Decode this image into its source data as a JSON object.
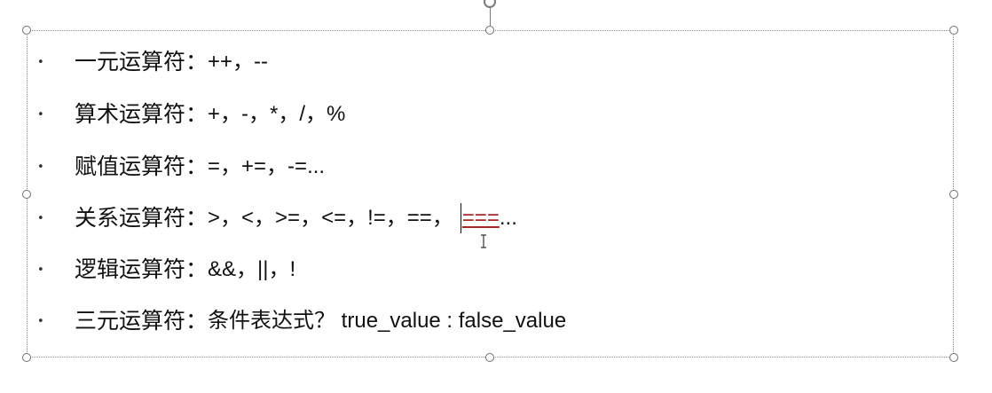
{
  "list": [
    {
      "label": "一元运算符：",
      "value": "++，--"
    },
    {
      "label": "算术运算符：",
      "value": "+，-，*，/，%"
    },
    {
      "label": "赋值运算符：",
      "value": "=，+=，-=..."
    },
    {
      "label": "关系运算符：",
      "value": ">，<，>=，<=，!=，==，",
      "highlight": "===",
      "suffix": "..."
    },
    {
      "label": "逻辑运算符：",
      "value": "&&，||，!"
    },
    {
      "label": "三元运算符：",
      "value": "条件表达式？ true_value : false_value"
    }
  ],
  "bullet_symbol": "•",
  "colors": {
    "highlight": "#a52a2a",
    "frame": "#8c8c8c"
  },
  "icons": {
    "cursor": "text-cursor-icon",
    "rotate": "rotate-handle-icon"
  }
}
